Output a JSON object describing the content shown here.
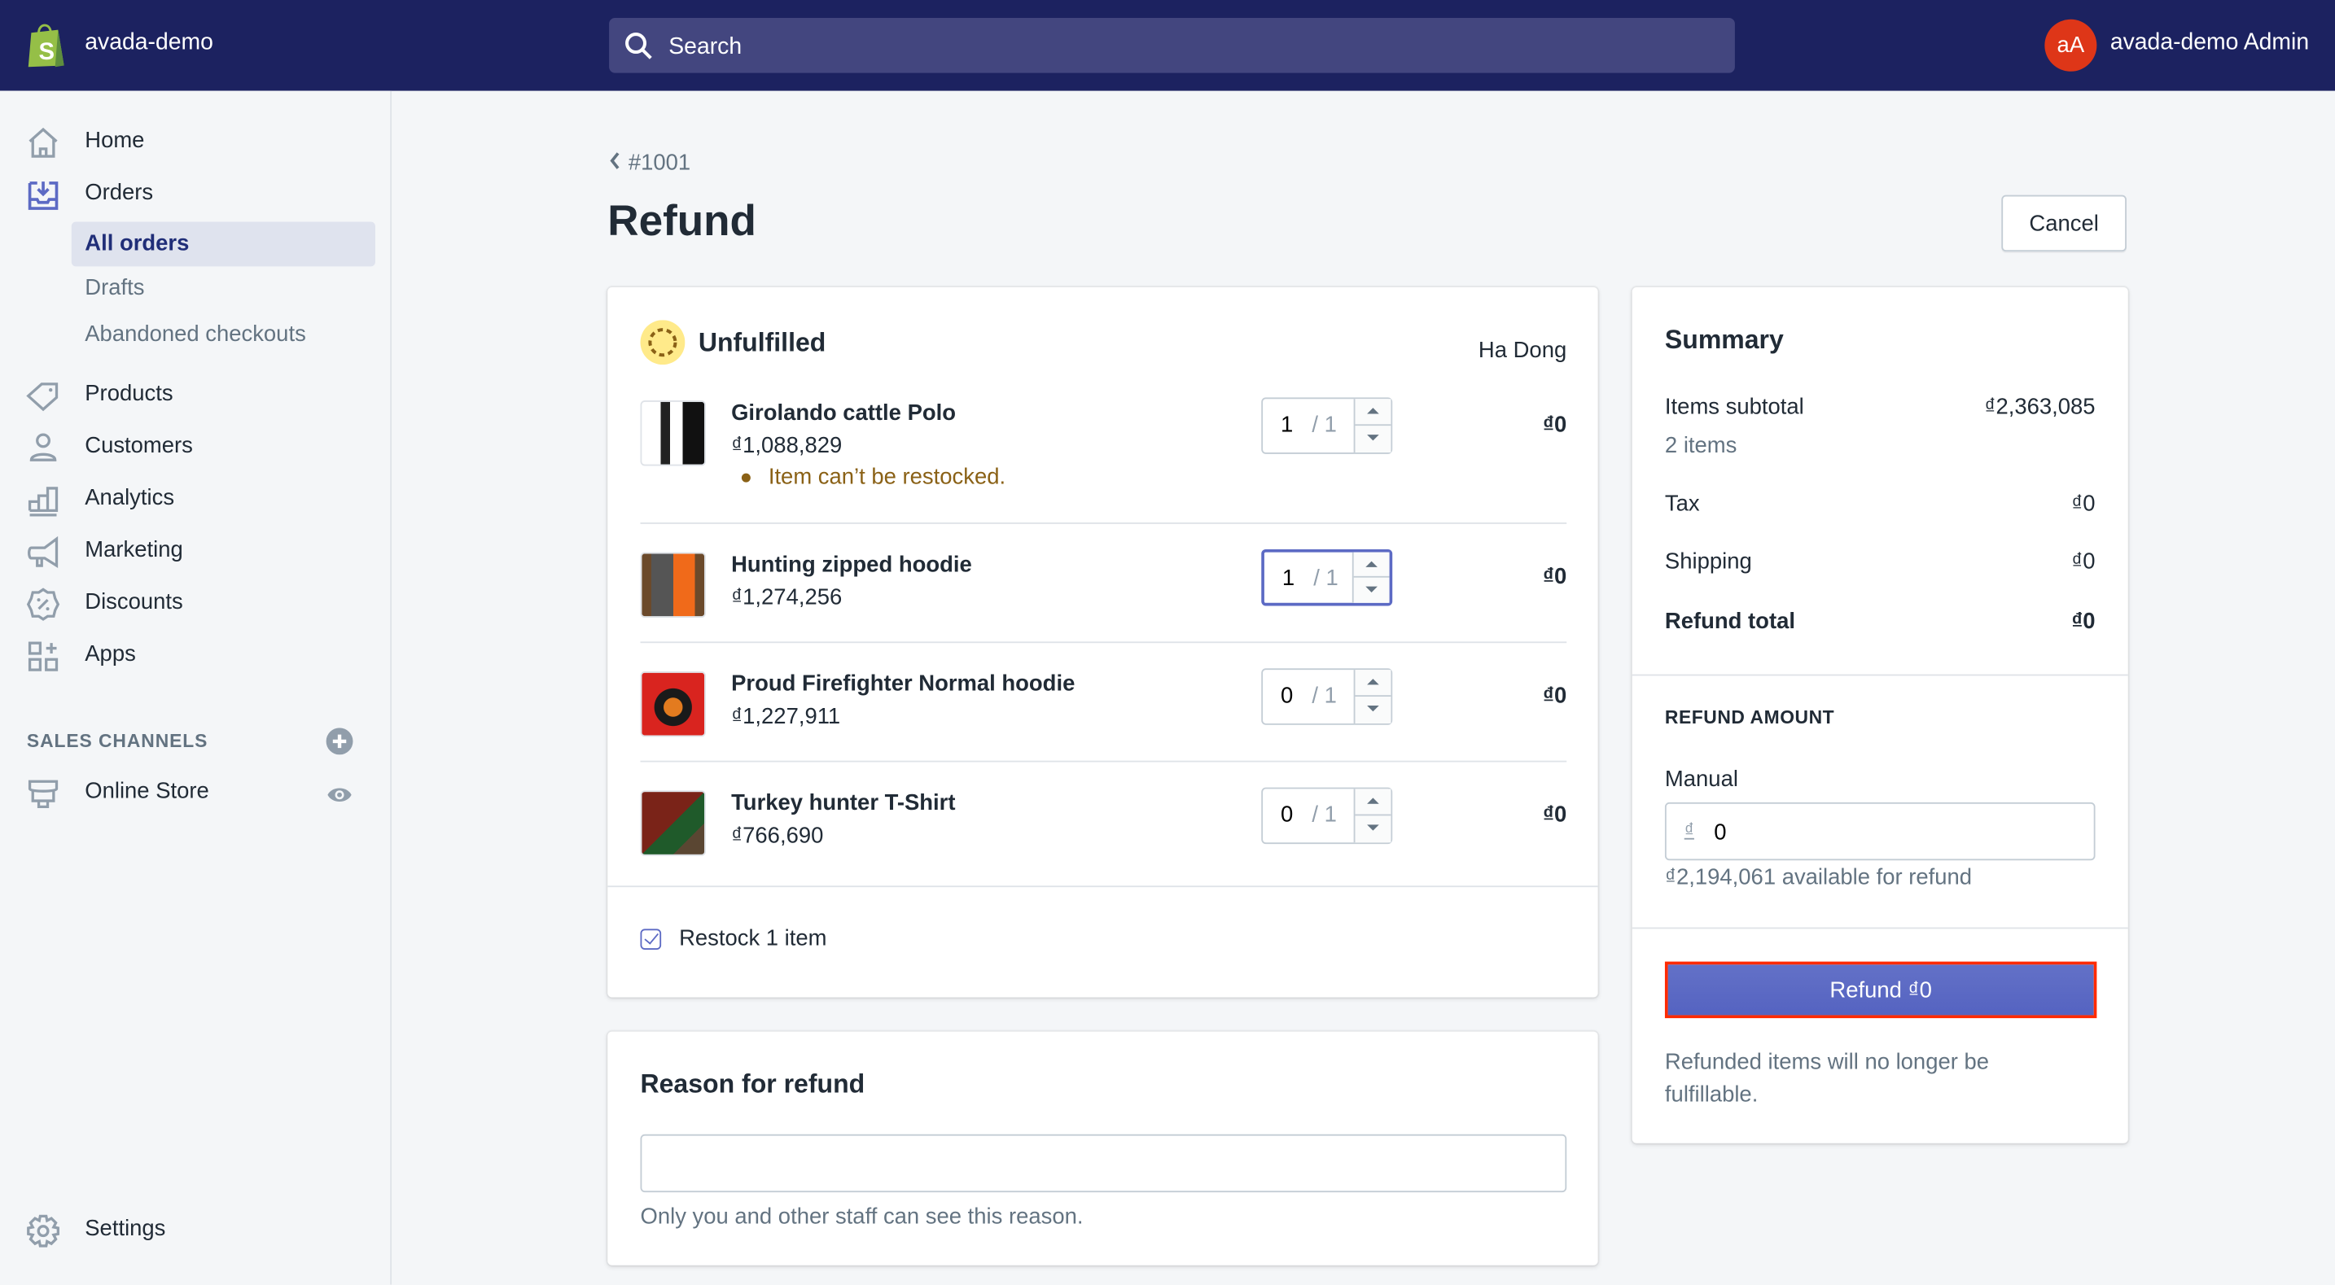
{
  "topbar": {
    "store_name": "avada-demo",
    "search_placeholder": "Search",
    "avatar_initials": "aA",
    "admin_name": "avada-demo Admin"
  },
  "sidebar": {
    "items": [
      {
        "label": "Home",
        "icon": "home-icon"
      },
      {
        "label": "Orders",
        "icon": "orders-icon"
      },
      {
        "label": "Products",
        "icon": "tag-icon"
      },
      {
        "label": "Customers",
        "icon": "person-icon"
      },
      {
        "label": "Analytics",
        "icon": "bar-chart-icon"
      },
      {
        "label": "Marketing",
        "icon": "megaphone-icon"
      },
      {
        "label": "Discounts",
        "icon": "discount-icon"
      },
      {
        "label": "Apps",
        "icon": "apps-icon"
      }
    ],
    "orders_sub": [
      {
        "label": "All orders",
        "active": true
      },
      {
        "label": "Drafts"
      },
      {
        "label": "Abandoned checkouts"
      }
    ],
    "sales_channels_heading": "SALES CHANNELS",
    "online_store": "Online Store",
    "settings": "Settings"
  },
  "page": {
    "breadcrumb": "#1001",
    "title": "Refund",
    "cancel_label": "Cancel"
  },
  "fulfillment": {
    "status": "Unfulfilled",
    "location": "Ha Dong",
    "line_items": [
      {
        "name": "Girolando cattle Polo",
        "price": "₫1,088,829",
        "qty": "1",
        "max": "/ 1",
        "total": "₫0",
        "warning": "Item can’t be restocked."
      },
      {
        "name": "Hunting zipped hoodie",
        "price": "₫1,274,256",
        "qty": "1",
        "max": "/ 1",
        "total": "₫0"
      },
      {
        "name": "Proud Firefighter Normal hoodie",
        "price": "₫1,227,911",
        "qty": "0",
        "max": "/ 1",
        "total": "₫0"
      },
      {
        "name": "Turkey hunter T-Shirt",
        "price": "₫766,690",
        "qty": "0",
        "max": "/ 1",
        "total": "₫0"
      }
    ],
    "restock_label": "Restock 1 item",
    "restock_checked": true
  },
  "reason": {
    "title": "Reason for refund",
    "value": "",
    "help": "Only you and other staff can see this reason."
  },
  "summary": {
    "title": "Summary",
    "items_subtotal_label": "Items subtotal",
    "items_subtotal_value": "₫2,363,085",
    "items_count": "2 items",
    "tax_label": "Tax",
    "tax_value": "₫0",
    "shipping_label": "Shipping",
    "shipping_value": "₫0",
    "refund_total_label": "Refund total",
    "refund_total_value": "₫0",
    "refund_amount_heading": "REFUND AMOUNT",
    "manual_label": "Manual",
    "manual_currency": "₫",
    "manual_value": "0",
    "available": "₫2,194,061 available for refund",
    "refund_button": "Refund ₫0",
    "refund_note": "Refunded items will no longer be fulfillable."
  },
  "colors": {
    "topbar": "#1c2260",
    "primary": "#5c6ac4",
    "avatar": "#de3618",
    "warning_text": "#8a6116",
    "highlight_border": "#ff2a00"
  }
}
